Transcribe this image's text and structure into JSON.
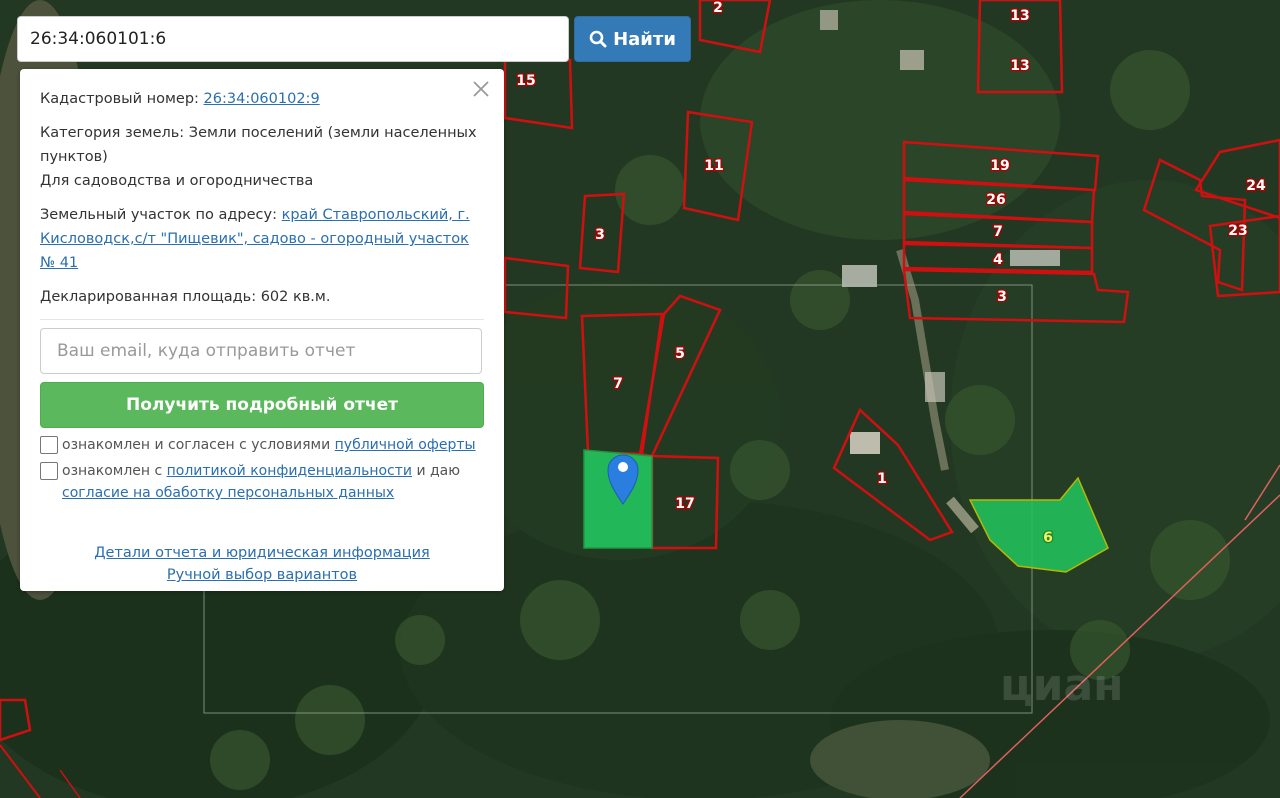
{
  "search": {
    "value": "26:34:060101:6",
    "button_label": "Найти"
  },
  "panel": {
    "cadastral_label": "Кадастровый номер:",
    "cadastral_number": "26:34:060102:9",
    "category_label": "Категория земель:",
    "category_value": "Земли поселений (земли населенных пунктов)",
    "usage": "Для садоводства и огородничества",
    "address_label": "Земельный участок по адресу:",
    "address_value": "край Ставропольский, г. Кисловодск,с/т \"Пищевик\", садово - огородный участок № 41",
    "area_label": "Декларированная площадь:",
    "area_value": "602 кв.м.",
    "email_placeholder": "Ваш email, куда отправить отчет",
    "report_button": "Получить подробный отчет",
    "consent1_text": "ознакомлен и согласен с условиями",
    "consent1_link": "публичной оферты",
    "consent2_text_a": "ознакомлен с",
    "consent2_link1": "политикой конфиденциальности",
    "consent2_text_b": "и даю",
    "consent2_link2": "согласие на обаботку персональных данных",
    "details_link": "Детали отчета и юридическая информация",
    "manual_link": "Ручной выбор вариантов"
  },
  "map": {
    "plot_labels": [
      "2",
      "13",
      "13",
      "15",
      "11",
      "19",
      "26",
      "7",
      "4",
      "3",
      "24",
      "23",
      "3",
      "5",
      "7",
      "17",
      "1",
      "6"
    ],
    "watermark": "циан"
  },
  "colors": {
    "search_button": "#337ab7",
    "report_button": "#5cb85c",
    "parcel_border": "#d01010",
    "selected_parcel": "#22c55e",
    "marker": "#2a7ee0"
  }
}
